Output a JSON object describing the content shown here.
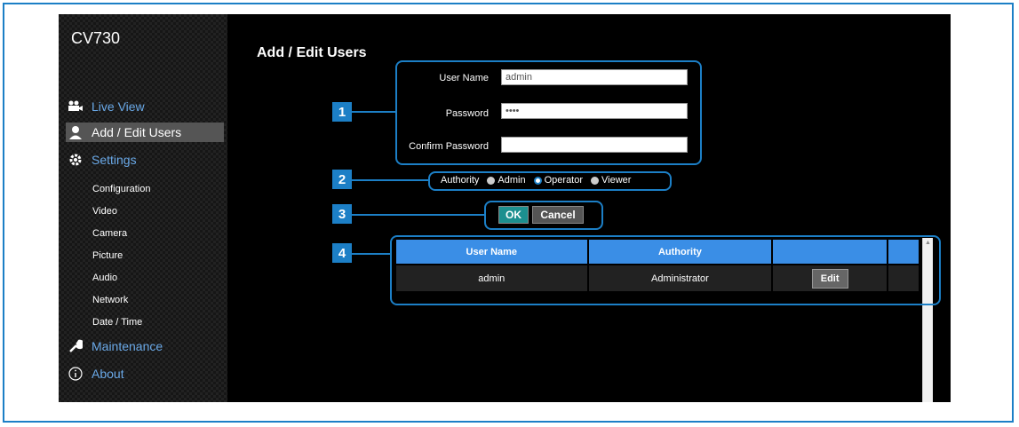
{
  "app": {
    "name": "CV730"
  },
  "nav": [
    {
      "label": "Live View",
      "icon": "camera-icon"
    },
    {
      "label": "Add / Edit Users",
      "icon": "user-icon",
      "active": true
    },
    {
      "label": "Settings",
      "icon": "gear-icon"
    }
  ],
  "settings_items": [
    "Configuration",
    "Video",
    "Camera",
    "Picture",
    "Audio",
    "Network",
    "Date / Time"
  ],
  "nav_bottom": [
    {
      "label": "Maintenance",
      "icon": "wrench-icon"
    },
    {
      "label": "About",
      "icon": "info-icon"
    }
  ],
  "page": {
    "title": "Add / Edit Users"
  },
  "form": {
    "username_label": "User Name",
    "username_value": "admin",
    "password_label": "Password",
    "password_value": "••••",
    "confirm_label": "Confirm Password",
    "confirm_value": ""
  },
  "authority": {
    "label": "Authority",
    "options": [
      "Admin",
      "Operator",
      "Viewer"
    ],
    "selected": "Operator"
  },
  "buttons": {
    "ok": "OK",
    "cancel": "Cancel"
  },
  "table": {
    "headers": [
      "User Name",
      "Authority",
      "",
      ""
    ],
    "rows": [
      {
        "user": "admin",
        "authority": "Administrator",
        "action": "Edit"
      }
    ]
  },
  "callouts": [
    "1",
    "2",
    "3",
    "4"
  ],
  "colors": {
    "accent": "#1c7fc6",
    "header": "#3a8ee6",
    "ok": "#1c8f8f"
  }
}
